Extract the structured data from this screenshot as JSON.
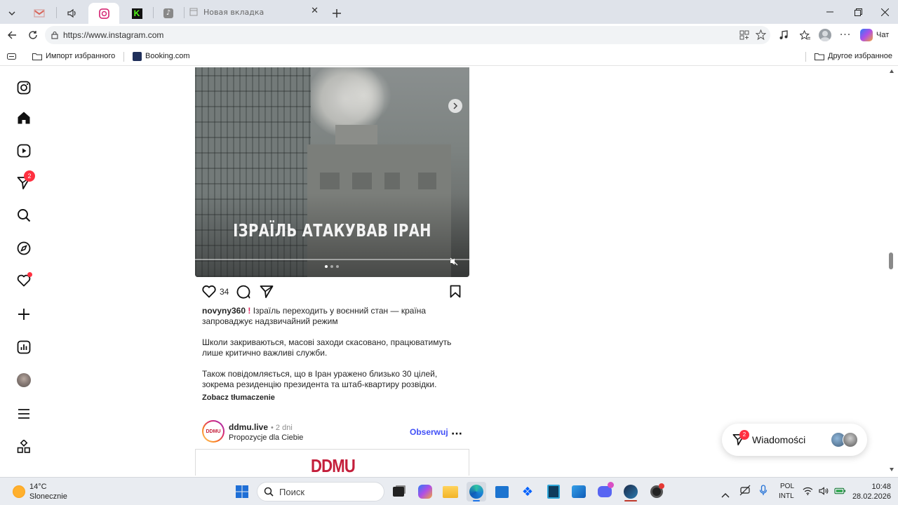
{
  "browser": {
    "tabs": [
      {
        "icon": "gmail-icon"
      },
      {
        "icon": "speaker-icon"
      },
      {
        "icon": "instagram-icon"
      },
      {
        "icon": "kick-icon"
      },
      {
        "icon": "tiktok-icon"
      }
    ],
    "new_tab_label": "Новая вкладка",
    "url": "https://www.instagram.com",
    "chat_label": "Чат",
    "bookmarks": {
      "import_label": "Импорт избранного",
      "booking_label": "Booking.com",
      "other_label": "Другое избранное"
    }
  },
  "sidebar": {
    "notifications_badge": "2"
  },
  "post": {
    "overlay_title": "ІЗРАЇЛЬ АТАКУВАВ ІРАН",
    "likes": "34",
    "author": "novyny360",
    "caption_1a": " Ізраїль переходить у воєнний стан — країна",
    "caption_1b": "запроваджує надзвичайний режим",
    "caption_2a": "Школи закриваються, масові заходи скасовано, працюватимуть",
    "caption_2b": "лише критично важливі служби.",
    "caption_3a": "Також повідомляється, що в Іран уражено близько 30 цілей,",
    "caption_3b": "зокрема резиденцію президента та штаб-квартиру розвідки.",
    "translate": "Zobacz tłumaczenie"
  },
  "next_post": {
    "author": "ddmu.live",
    "age": "• 2 dni",
    "subtitle": "Propozycje dla Ciebie",
    "follow": "Obserwuj",
    "avatar_text": "DDMU",
    "media_text": "DDMU"
  },
  "messages": {
    "label": "Wiadomości",
    "badge": "2"
  },
  "taskbar": {
    "weather_temp": "14°C",
    "weather_desc": "Slonecznie",
    "search_placeholder": "Поиск",
    "lang_1": "POL",
    "lang_2": "INTL",
    "time": "10:48",
    "date": "28.02.2026"
  }
}
